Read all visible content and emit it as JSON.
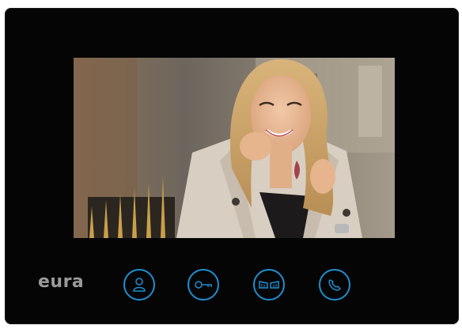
{
  "brand": {
    "logo_text": "eura"
  },
  "screen": {
    "content": "camera-feed-visitor"
  },
  "buttons": [
    {
      "icon": "person-monitor-icon"
    },
    {
      "icon": "key-unlock-icon"
    },
    {
      "icon": "gate-open-icon"
    },
    {
      "icon": "handset-call-icon"
    }
  ],
  "colors": {
    "panel": "#050505",
    "button_ring": "#1e8fd0",
    "logo": "#9a9a9a"
  }
}
